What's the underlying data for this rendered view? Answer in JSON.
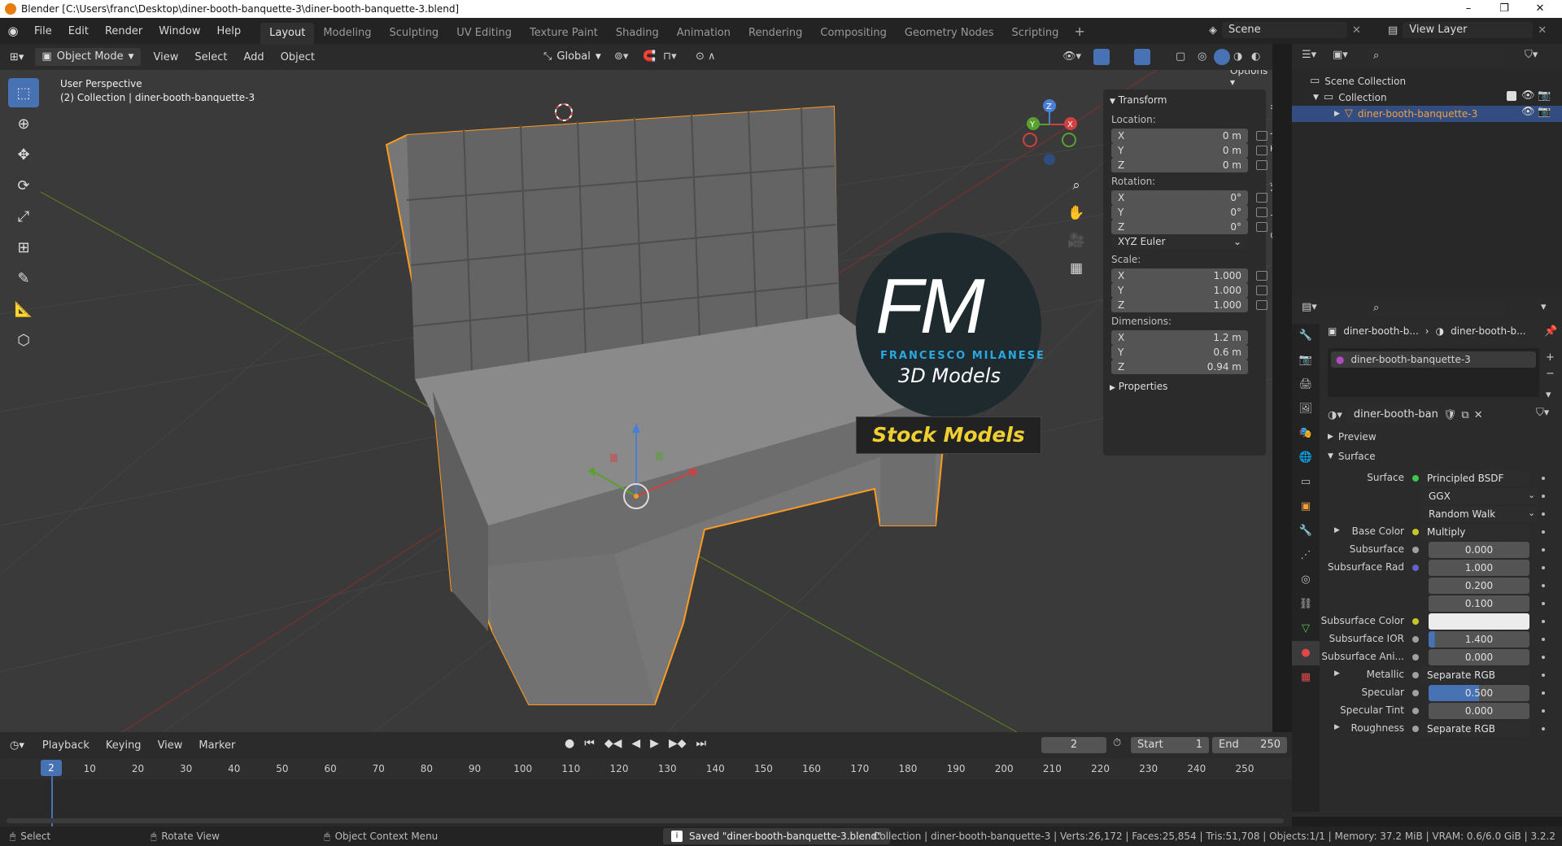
{
  "titlebar": {
    "title": "Blender [C:\\Users\\franc\\Desktop\\diner-booth-banquette-3\\diner-booth-banquette-3.blend]"
  },
  "menu": [
    "File",
    "Edit",
    "Render",
    "Window",
    "Help"
  ],
  "workspaces": [
    "Layout",
    "Modeling",
    "Sculpting",
    "UV Editing",
    "Texture Paint",
    "Shading",
    "Animation",
    "Rendering",
    "Compositing",
    "Geometry Nodes",
    "Scripting"
  ],
  "active_workspace": "Layout",
  "scene": {
    "name": "Scene",
    "view_layer": "View Layer"
  },
  "viewport_header": {
    "mode": "Object Mode",
    "menus": [
      "View",
      "Select",
      "Add",
      "Object"
    ],
    "orientation": "Global",
    "options": "Options"
  },
  "viewport": {
    "perspective": "User Perspective",
    "collection_info": "(2) Collection | diner-booth-banquette-3",
    "watermark": {
      "initials": "FM",
      "name": "FRANCESCO MILANESE",
      "tagline": "3D Models",
      "banner": "Stock Models"
    },
    "gizmo_axes": [
      "X",
      "Y",
      "Z"
    ]
  },
  "npanel": {
    "section": "Transform",
    "location_label": "Location:",
    "location": [
      {
        "k": "X",
        "v": "0 m"
      },
      {
        "k": "Y",
        "v": "0 m"
      },
      {
        "k": "Z",
        "v": "0 m"
      }
    ],
    "rotation_label": "Rotation:",
    "rotation": [
      {
        "k": "X",
        "v": "0°"
      },
      {
        "k": "Y",
        "v": "0°"
      },
      {
        "k": "Z",
        "v": "0°"
      }
    ],
    "rotation_mode": "XYZ Euler",
    "scale_label": "Scale:",
    "scale": [
      {
        "k": "X",
        "v": "1.000"
      },
      {
        "k": "Y",
        "v": "1.000"
      },
      {
        "k": "Z",
        "v": "1.000"
      }
    ],
    "dimensions_label": "Dimensions:",
    "dimensions": [
      {
        "k": "X",
        "v": "1.2 m"
      },
      {
        "k": "Y",
        "v": "0.6 m"
      },
      {
        "k": "Z",
        "v": "0.94 m"
      }
    ],
    "properties": "Properties",
    "tabs": [
      "Item",
      "Tool",
      "View",
      "Create"
    ]
  },
  "outliner": {
    "root": "Scene Collection",
    "collection": "Collection",
    "object": "diner-booth-banquette-3"
  },
  "properties": {
    "breadcrumb": [
      "diner-booth-b...",
      "diner-booth-b..."
    ],
    "material_slot": "diner-booth-banquette-3",
    "material_name": "diner-booth-banquett...",
    "preview": "Preview",
    "surface_section": "Surface",
    "rows": [
      {
        "label": "Surface",
        "value": "Principled BSDF",
        "sock": "#3ec74b",
        "style": "dark"
      },
      {
        "label": "",
        "value": "GGX",
        "style": "select"
      },
      {
        "label": "",
        "value": "Random Walk",
        "style": "select"
      },
      {
        "label": "Base Color",
        "value": "Multiply",
        "sock": "#c7c729",
        "style": "dark",
        "expand": true
      },
      {
        "label": "Subsurface",
        "value": "0.000",
        "sock": "#a0a0a0",
        "style": "num"
      },
      {
        "label": "Subsurface Rad",
        "value": "1.000",
        "sock": "#6363c7",
        "style": "num"
      },
      {
        "label": "",
        "value": "0.200",
        "style": "num"
      },
      {
        "label": "",
        "value": "0.100",
        "style": "num"
      },
      {
        "label": "Subsurface Color",
        "value": "",
        "sock": "#c7c729",
        "style": "color"
      },
      {
        "label": "Subsurface IOR",
        "value": "1.400",
        "sock": "#a0a0a0",
        "style": "slider",
        "fill": 0.06
      },
      {
        "label": "Subsurface Ani...",
        "value": "0.000",
        "sock": "#a0a0a0",
        "style": "num"
      },
      {
        "label": "Metallic",
        "value": "Separate RGB",
        "sock": "#a0a0a0",
        "style": "dark",
        "expand": true
      },
      {
        "label": "Specular",
        "value": "0.500",
        "sock": "#a0a0a0",
        "style": "slider",
        "fill": 0.5
      },
      {
        "label": "Specular Tint",
        "value": "0.000",
        "sock": "#a0a0a0",
        "style": "num"
      },
      {
        "label": "Roughness",
        "value": "Separate RGB",
        "sock": "#a0a0a0",
        "style": "dark",
        "expand": true
      }
    ]
  },
  "timeline": {
    "menus": [
      "Playback",
      "Keying",
      "View",
      "Marker"
    ],
    "current_frame": "2",
    "start_label": "Start",
    "start": "1",
    "end_label": "End",
    "end": "250",
    "ticks": [
      "10",
      "20",
      "30",
      "40",
      "50",
      "60",
      "70",
      "80",
      "90",
      "100",
      "110",
      "120",
      "130",
      "140",
      "150",
      "160",
      "170",
      "180",
      "190",
      "200",
      "210",
      "220",
      "230",
      "240",
      "250"
    ]
  },
  "statusbar": {
    "select": "Select",
    "rotate": "Rotate View",
    "context": "Object Context Menu",
    "message": "Saved \"diner-booth-banquette-3.blend\"",
    "stats": "Collection | diner-booth-banquette-3 | Verts:26,172 | Faces:25,854 | Tris:51,708 | Objects:1/1 | Memory: 37.2 MiB | VRAM: 0.6/6.0 GiB | 3.2.2"
  }
}
